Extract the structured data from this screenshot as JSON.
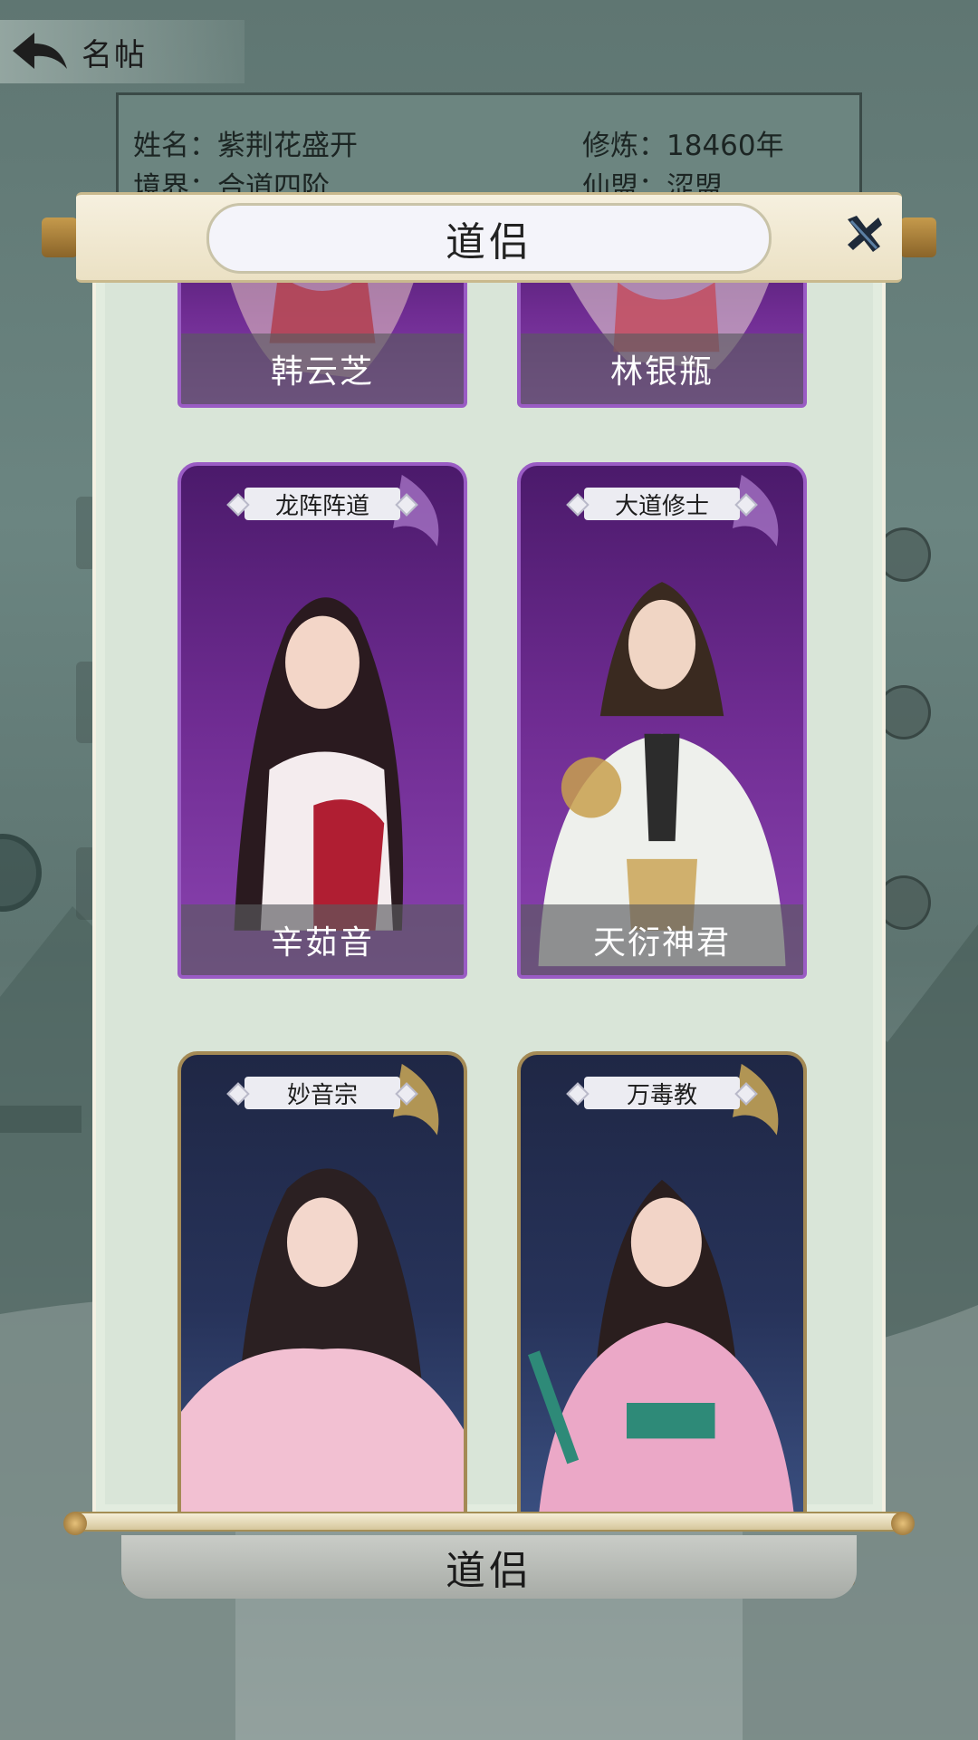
{
  "topbar": {
    "title": "名帖"
  },
  "profile": {
    "name_label": "姓名：紫荆花盛开",
    "cultivation_label": "修炼：18460年",
    "realm_label": "境界：合道四阶",
    "alliance_label": "仙盟：涩盟"
  },
  "dialog": {
    "title": "道侣"
  },
  "partners": [
    {
      "name": "韩云芝",
      "sect": ""
    },
    {
      "name": "林银瓶",
      "sect": ""
    },
    {
      "name": "辛茹音",
      "sect": "龙阵阵道"
    },
    {
      "name": "天衍神君",
      "sect": "大道修士"
    },
    {
      "name": "",
      "sect": "妙音宗"
    },
    {
      "name": "",
      "sect": "万毒教"
    }
  ],
  "bottom": {
    "label": "道侣"
  },
  "colors": {
    "purple_card": "#6f2c92",
    "blue_card": "#27335a",
    "scroll_bg": "#d9e5d8"
  },
  "icons": {
    "back": "back-arrow-icon",
    "close": "close-x-icon"
  }
}
